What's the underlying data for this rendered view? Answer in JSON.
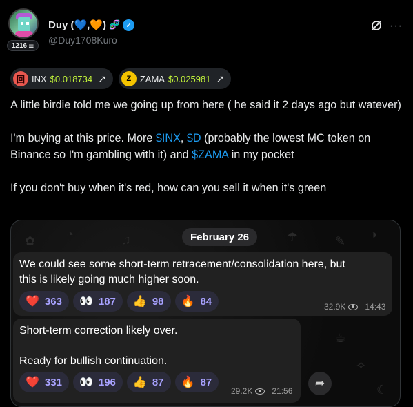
{
  "author": {
    "display_name": "Duy (💙,🧡)",
    "handle": "@Duy1708Kuro",
    "avatar_badge_count": "1216",
    "badge_glyph": "𝌆",
    "dna_glyph": "🧬",
    "verified_glyph": "✓"
  },
  "header_icons": {
    "grok": "grok-icon",
    "more": "···"
  },
  "tokens": [
    {
      "symbol": "INX",
      "price": "$0.018734",
      "arrow": "↗",
      "coin_color": "#e8574f",
      "coin_letter": "回"
    },
    {
      "symbol": "ZAMA",
      "price": "$0.025981",
      "arrow": "↗",
      "coin_color": "#f5c400",
      "coin_letter": "Z"
    }
  ],
  "tweet": {
    "p1": "A little birdie told me we going up from here ( he said it 2 days ago but watever)",
    "p2_a": "I'm buying at this price. More ",
    "p2_inx": "$INX",
    "p2_b": ", ",
    "p2_d": "$D",
    "p2_c": " (probably the lowest MC token on Binance so I'm gambling with it) and ",
    "p2_zama": "$ZAMA",
    "p2_e": " in my pocket",
    "p3": "If you don't buy when it's red, how can you sell it when it's green"
  },
  "media": {
    "date": "February 26",
    "messages": [
      {
        "text_line1": "We could see some short-term retracement/consolidation here, but",
        "text_line2": "this is likely going much higher soon.",
        "reactions": [
          {
            "emoji": "❤️",
            "count": "363"
          },
          {
            "emoji": "👀",
            "count": "187"
          },
          {
            "emoji": "👍",
            "count": "98"
          },
          {
            "emoji": "🔥",
            "count": "84"
          }
        ],
        "views": "32.9K",
        "time": "14:43"
      },
      {
        "text_line1": "Short-term correction likely over.",
        "text_line2": "Ready for bullish continuation.",
        "reactions": [
          {
            "emoji": "❤️",
            "count": "331"
          },
          {
            "emoji": "👀",
            "count": "196"
          },
          {
            "emoji": "👍",
            "count": "87"
          },
          {
            "emoji": "🔥",
            "count": "87"
          }
        ],
        "views": "29.2K",
        "time": "21:56"
      }
    ],
    "share_glyph": "➦"
  }
}
